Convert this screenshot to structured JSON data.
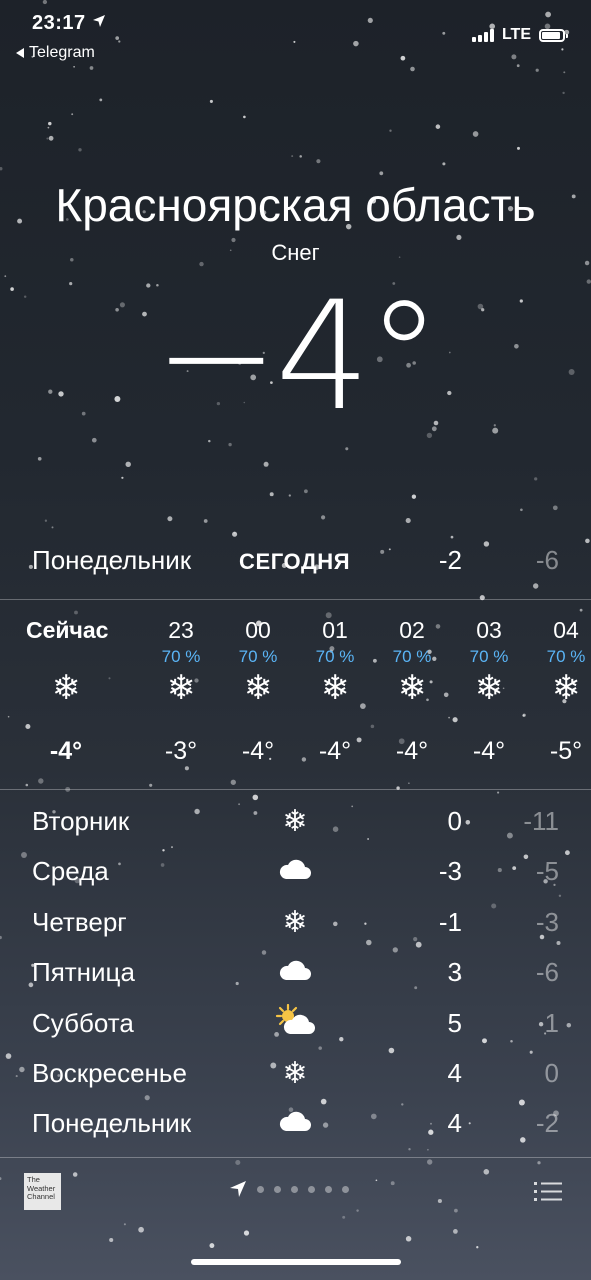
{
  "status_bar": {
    "time": "23:17",
    "back_app": "Telegram",
    "network": "LTE"
  },
  "location": {
    "city": "Красноярская область",
    "condition": "Снег",
    "temperature": "−4°"
  },
  "today": {
    "day": "Понедельник",
    "tag": "СЕГОДНЯ",
    "high": "-2",
    "low": "-6"
  },
  "hourly": [
    {
      "time": "Сейчас",
      "precip": "",
      "icon": "snowflake-icon",
      "temp": "-4°"
    },
    {
      "time": "23",
      "precip": "70 %",
      "icon": "snowflake-icon",
      "temp": "-3°"
    },
    {
      "time": "00",
      "precip": "70 %",
      "icon": "snowflake-icon",
      "temp": "-4°"
    },
    {
      "time": "01",
      "precip": "70 %",
      "icon": "snowflake-icon",
      "temp": "-4°"
    },
    {
      "time": "02",
      "precip": "70 %",
      "icon": "snowflake-icon",
      "temp": "-4°"
    },
    {
      "time": "03",
      "precip": "70 %",
      "icon": "snowflake-icon",
      "temp": "-4°"
    },
    {
      "time": "04",
      "precip": "70 %",
      "icon": "snowflake-icon",
      "temp": "-5°"
    }
  ],
  "daily": [
    {
      "day": "Вторник",
      "icon": "snowflake-icon",
      "high": "0",
      "low": "-11"
    },
    {
      "day": "Среда",
      "icon": "cloud-icon",
      "high": "-3",
      "low": "-5"
    },
    {
      "day": "Четверг",
      "icon": "snowflake-icon",
      "high": "-1",
      "low": "-3"
    },
    {
      "day": "Пятница",
      "icon": "cloud-icon",
      "high": "3",
      "low": "-6"
    },
    {
      "day": "Суббота",
      "icon": "partly-sunny-icon",
      "high": "5",
      "low": "1"
    },
    {
      "day": "Воскресенье",
      "icon": "snowflake-icon",
      "high": "4",
      "low": "0"
    },
    {
      "day": "Понедельник",
      "icon": "cloud-icon",
      "high": "4",
      "low": "-2"
    }
  ],
  "footer": {
    "provider_logo": "The Weather Channel",
    "page_dots": 6
  },
  "colors": {
    "precip_blue": "#5ab4f5",
    "low_temp": "rgba(255,255,255,0.45)"
  }
}
